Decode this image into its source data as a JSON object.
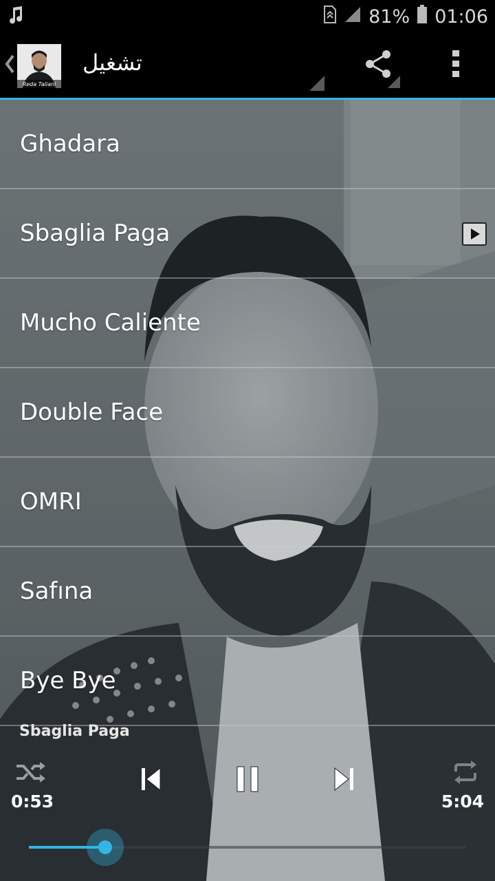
{
  "status_bar": {
    "icons": [
      "music-note-icon",
      "sim-icon",
      "signal-icon",
      "battery-icon"
    ],
    "battery_percent": "81%",
    "time": "01:06"
  },
  "action_bar": {
    "title": "تشغيل",
    "avatar_caption": "Reda Taliani",
    "icons": [
      "back-chevron-icon",
      "share-icon",
      "overflow-menu-icon"
    ],
    "accent_color": "#33b5e5"
  },
  "playlist": {
    "items": [
      {
        "label": "Ghadara"
      },
      {
        "label": "Sbaglia Paga",
        "playing": true
      },
      {
        "label": "Mucho Caliente"
      },
      {
        "label": "Double Face"
      },
      {
        "label": "OMRI"
      },
      {
        "label": "Safına"
      },
      {
        "label": "Bye Bye"
      }
    ]
  },
  "player": {
    "now_playing": "Sbaglia Paga",
    "elapsed": "0:53",
    "duration": "5:04",
    "progress_fraction": 0.175,
    "controls": [
      "shuffle-icon",
      "previous-icon",
      "pause-icon",
      "next-icon",
      "repeat-icon"
    ]
  }
}
